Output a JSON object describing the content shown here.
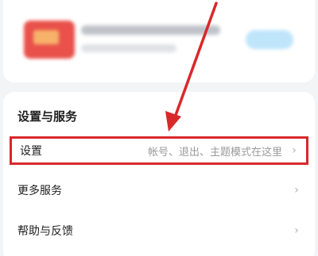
{
  "promo": {
    "title_blurred": "限时 · 10天会员免费领",
    "subtitle_blurred": "",
    "action_blurred": "领取"
  },
  "settings_section": {
    "title": "设置与服务",
    "items": [
      {
        "label": "设置",
        "hint": "帐号、退出、主题模式在这里",
        "chevron": "›",
        "highlighted": true
      },
      {
        "label": "更多服务",
        "hint": "",
        "chevron": "›",
        "highlighted": false
      },
      {
        "label": "帮助与反馈",
        "hint": "",
        "chevron": "›",
        "highlighted": false
      }
    ]
  },
  "annotation": {
    "arrow_color": "#d8282a",
    "highlight_color": "#d8282a"
  }
}
